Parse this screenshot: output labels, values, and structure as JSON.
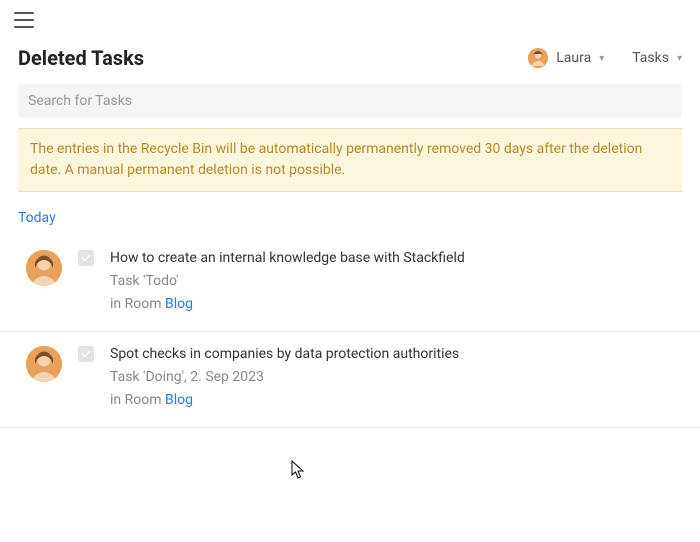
{
  "header": {
    "title": "Deleted Tasks",
    "user_name": "Laura",
    "type_label": "Tasks"
  },
  "search": {
    "placeholder": "Search for Tasks"
  },
  "notice": "The entries in the Recycle Bin will be automatically permanently removed 30 days after the deletion date. A manual permanent deletion is not possible.",
  "section_label": "Today",
  "tasks": [
    {
      "title": "How to create an internal knowledge base with Stackfield",
      "meta": "Task 'Todo'",
      "room_prefix": "in Room ",
      "room_name": "Blog"
    },
    {
      "title": "Spot checks in companies by data protection authorities",
      "meta": "Task 'Doing', 2. Sep 2023",
      "room_prefix": "in Room ",
      "room_name": "Blog"
    }
  ]
}
